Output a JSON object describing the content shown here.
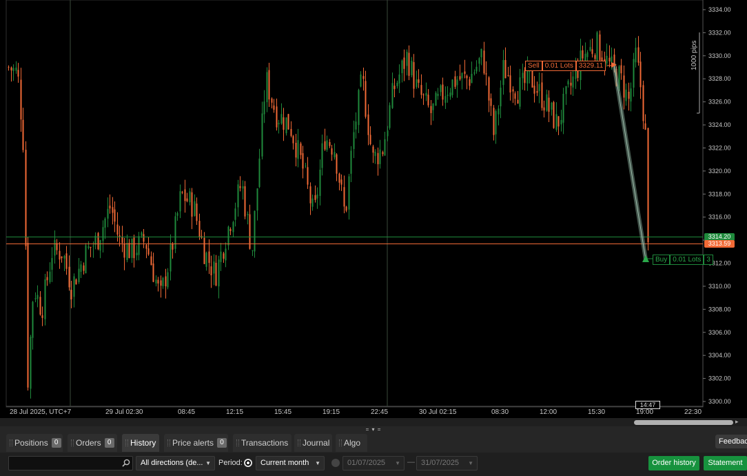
{
  "chart": {
    "colors": {
      "up": "#1f8a3c",
      "down": "#f26a36",
      "background": "#000000",
      "axis_text": "#c8c8c8",
      "grid": "#2d3b2d"
    },
    "y_ticks": [
      "3334.00",
      "3332.00",
      "3330.00",
      "3328.00",
      "3326.00",
      "3324.00",
      "3322.00",
      "3320.00",
      "3318.00",
      "3316.00",
      "3314.00",
      "3312.00",
      "3310.00",
      "3308.00",
      "3306.00",
      "3304.00",
      "3302.00",
      "3300.00"
    ],
    "x_ticks": [
      "28 Jul 2025, UTC+7",
      "29 Jul 02:30",
      "08:45",
      "12:15",
      "15:45",
      "19:15",
      "22:45",
      "30 Jul 02:15",
      "08:30",
      "12:00",
      "15:30",
      "19:00",
      "22:30"
    ],
    "pips_label": "1000 pips",
    "ask_price": "3314.20",
    "bid_price": "3313.59",
    "sell_position": {
      "side": "Sell",
      "lots": "0.01 Lots",
      "price": "3329.11"
    },
    "buy_position": {
      "side": "Buy",
      "lots": "0.01 Lots",
      "price_partial": "3"
    },
    "time_marker": "14:47"
  },
  "splitter_grip": "= ▾ =",
  "tabs": [
    {
      "label": "Positions",
      "badge": "0",
      "active": false
    },
    {
      "label": "Orders",
      "badge": "0",
      "active": false
    },
    {
      "label": "History",
      "badge": "",
      "active": true
    },
    {
      "label": "Price alerts",
      "badge": "0",
      "active": false
    },
    {
      "label": "Transactions",
      "badge": "",
      "active": false
    },
    {
      "label": "Journal",
      "badge": "",
      "active": false
    },
    {
      "label": "Algo",
      "badge": "",
      "active": false
    }
  ],
  "feedback_label": "Feedback",
  "filters": {
    "search_value": "",
    "direction": "All directions (de...",
    "period_label": "Period:",
    "period_value": "Current month",
    "date_from": "01/07/2025",
    "date_to": "31/07/2025",
    "date_separator": "—",
    "order_history_label": "Order history",
    "statement_label": "Statement"
  }
}
